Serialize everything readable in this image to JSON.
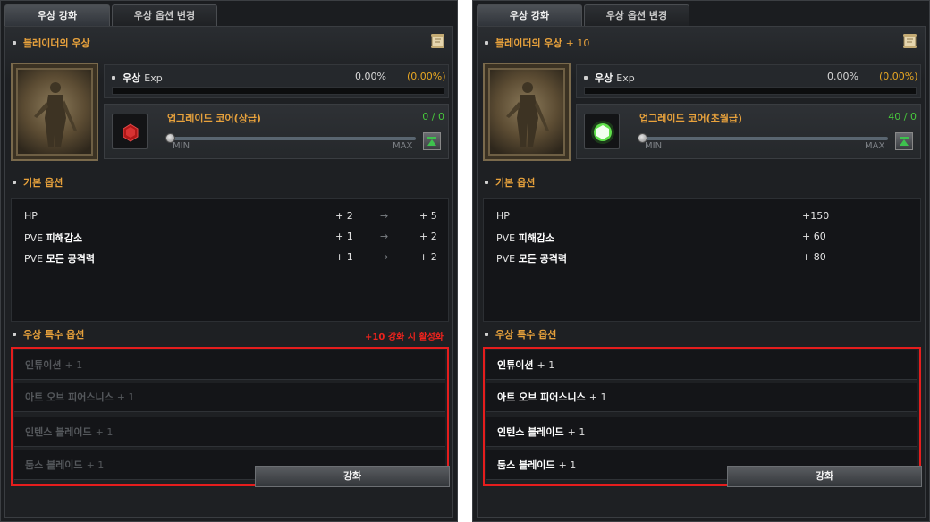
{
  "left": {
    "tabs": {
      "active": "우상 강화",
      "inactive": "우상 옵션 변경"
    },
    "title": "블레이더의 우상",
    "title_level": "",
    "exp": {
      "label_bold": "우상",
      "label_text": "Exp",
      "value": "0.00%",
      "percent": "(0.00%)"
    },
    "core": {
      "name": "업그레이드 코어(상급)",
      "count": "0 / 0",
      "min": "MIN",
      "max": "MAX"
    },
    "basic_header": "기본 옵션",
    "stats": [
      {
        "prefix": "HP",
        "strong": "",
        "from": "+ 2",
        "arrow": "→",
        "to": "+ 5"
      },
      {
        "prefix": "PVE",
        "strong": "피해감소",
        "from": "+ 1",
        "arrow": "→",
        "to": "+ 2"
      },
      {
        "prefix": "PVE",
        "strong": "모든 공격력",
        "from": "+ 1",
        "arrow": "→",
        "to": "+ 2"
      }
    ],
    "special_header": "우상 특수 옵션",
    "special_note": "+10 강화 시 활성화",
    "specials": [
      {
        "name": "인튜이션",
        "value": "+ 1"
      },
      {
        "name": "아트 오브 피어스니스",
        "value": "+ 1"
      },
      {
        "name": "인텐스 블레이드",
        "value": "+ 1"
      },
      {
        "name": "둠스 블레이드",
        "value": "+ 1"
      }
    ],
    "button": "강화"
  },
  "right": {
    "tabs": {
      "active": "우상 강화",
      "inactive": "우상 옵션 변경"
    },
    "title": "블레이더의 우상",
    "title_level": "+ 10",
    "exp": {
      "label_bold": "우상",
      "label_text": "Exp",
      "value": "0.00%",
      "percent": "(0.00%)"
    },
    "core": {
      "name": "업그레이드 코어(초월급)",
      "count": "40 / 0",
      "min": "MIN",
      "max": "MAX"
    },
    "basic_header": "기본 옵션",
    "stats": [
      {
        "prefix": "HP",
        "strong": "",
        "value": "+150"
      },
      {
        "prefix": "PVE",
        "strong": "피해감소",
        "value": "+ 60"
      },
      {
        "prefix": "PVE",
        "strong": "모든 공격력",
        "value": "+ 80"
      }
    ],
    "special_header": "우상 특수 옵션",
    "specials": [
      {
        "name": "인튜이션",
        "value": "+ 1"
      },
      {
        "name": "아트 오브 피어스니스",
        "value": "+ 1"
      },
      {
        "name": "인텐스 블레이드",
        "value": "+ 1"
      },
      {
        "name": "둠스 블레이드",
        "value": "+ 1"
      }
    ],
    "button": "강화"
  },
  "colors": {
    "accent": "#e8a23c",
    "count_green": "#47c83c",
    "warning_red": "#f0231d",
    "highlight_border": "#e51d1d"
  },
  "icons": {
    "scroll": "scroll-icon",
    "portrait": "blader-statue-portrait",
    "core_left": "red-core-gem-icon",
    "core_right": "green-core-gem-icon",
    "max": "max-arrow-icon"
  }
}
